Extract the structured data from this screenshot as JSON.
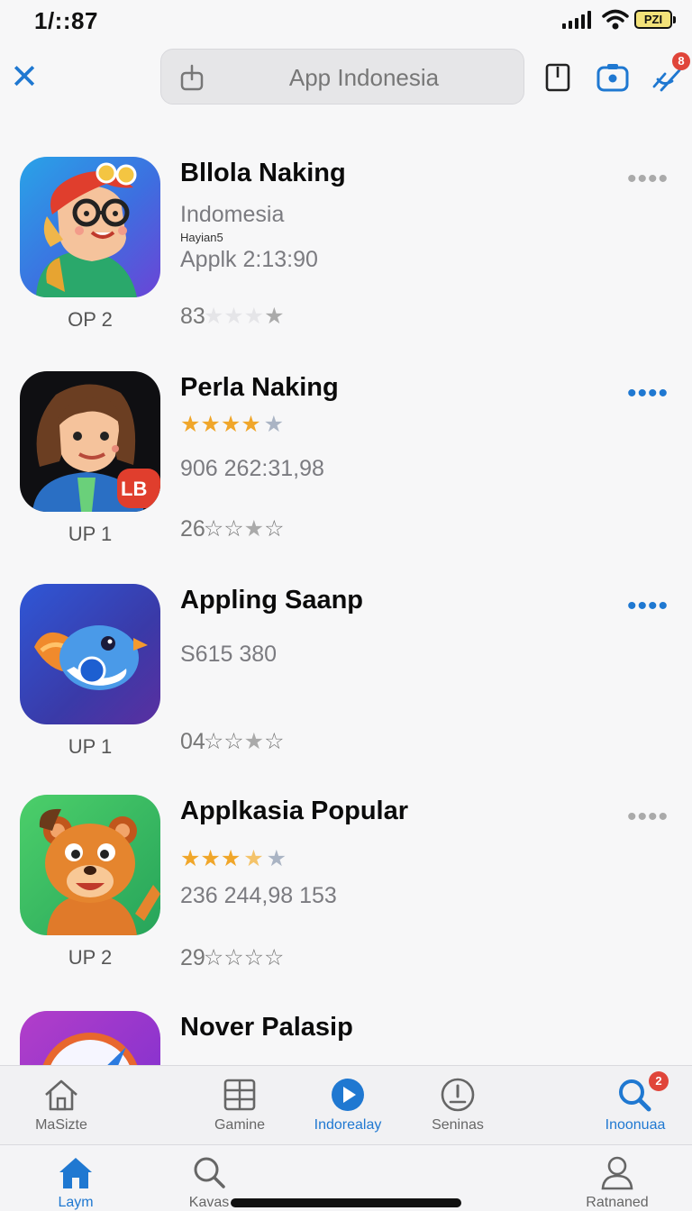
{
  "status_bar": {
    "time": "1/::87",
    "battery_label": "PZI"
  },
  "top_bar": {
    "search": {
      "value": "App Indonesia",
      "placeholder": "App Indonesia"
    },
    "notification_count": "8"
  },
  "apps": [
    {
      "title": "Bllola Naking",
      "line1": "Indomesia",
      "small": "Hayian5",
      "line2": "Applk 2:13:90",
      "rank": "OP 2",
      "rating_text": "83",
      "more_color": "#aaaaaa"
    },
    {
      "title": "Perla Naking",
      "line1": "",
      "line2": "906 262:31,98",
      "rank": "UP 1",
      "rating_text": "26",
      "more_color": "#1f78d1",
      "stars": 4,
      "icon_badge": "LB"
    },
    {
      "title": "Appling Saanp",
      "line1": "S615 380",
      "line2": "",
      "rank": "UP 1",
      "rating_text": "04",
      "more_color": "#1f78d1"
    },
    {
      "title": "Applkasia Popular",
      "line1": "",
      "line2": "236 244,98 153",
      "rank": "UP 2",
      "rating_text": "29",
      "more_color": "#aaaaaa",
      "stars": 3.5
    },
    {
      "title": "Nover Palasip",
      "rank": "",
      "rating_text": ""
    }
  ],
  "tabbar_top": [
    {
      "label": "MaSizte",
      "icon": "home-outline-icon"
    },
    {
      "label": "Gamine",
      "icon": "grid-icon"
    },
    {
      "label": "Indorealay",
      "icon": "play-circle-icon"
    },
    {
      "label": "Seninas",
      "icon": "info-circle-icon"
    },
    {
      "label": "Inoonuaa",
      "icon": "search-icon",
      "badge": "2"
    }
  ],
  "tabbar_bottom": [
    {
      "label": "Laym",
      "icon": "home-filled-icon"
    },
    {
      "label": "Kavas",
      "icon": "search-icon"
    },
    {
      "label": "Ratnaned",
      "icon": "person-icon"
    }
  ]
}
